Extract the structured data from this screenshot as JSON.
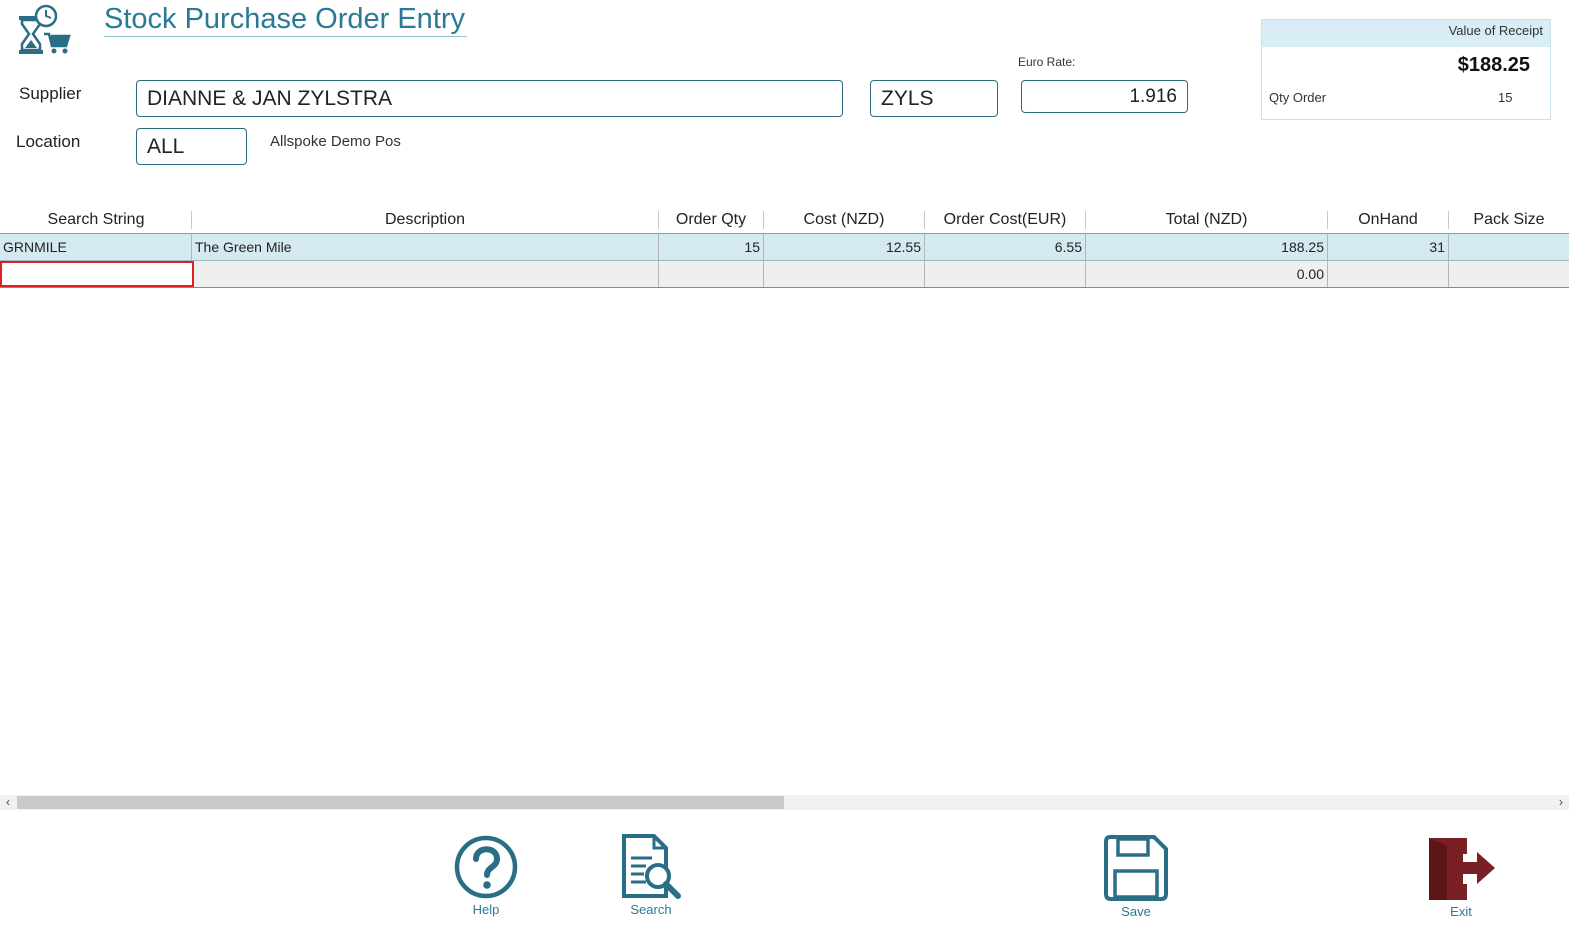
{
  "header": {
    "title": "Stock Purchase Order Entry",
    "logo_icon": "hourglass-cart-icon"
  },
  "form": {
    "supplier_label": "Supplier",
    "supplier_name": "DIANNE & JAN ZYLSTRA",
    "supplier_code": "ZYLS",
    "euro_rate_label": "Euro Rate:",
    "euro_rate": "1.916",
    "location_label": "Location",
    "location_code": "ALL",
    "location_name": "Allspoke Demo Pos"
  },
  "summary": {
    "title": "Value of Receipt",
    "value": "$188.25",
    "qty_order_label": "Qty Order",
    "qty_order": "15"
  },
  "grid": {
    "columns": [
      "Search String",
      "Description",
      "Order Qty",
      "Cost (NZD)",
      "Order Cost(EUR)",
      "Total (NZD)",
      "OnHand",
      "Pack Size"
    ],
    "rows": [
      [
        "GRNMILE",
        "The Green Mile",
        "15",
        "12.55",
        "6.55",
        "188.25",
        "31",
        ""
      ],
      [
        "",
        "",
        "",
        "",
        "",
        "0.00",
        "",
        ""
      ]
    ]
  },
  "footer": {
    "help_label": "Help",
    "search_label": "Search",
    "save_label": "Save",
    "exit_label": "Exit"
  },
  "colors": {
    "accent": "#2a7a97",
    "selected_row": "#d4e9f0",
    "exit": "#7a1f24",
    "active_cell_border": "#e02020"
  }
}
